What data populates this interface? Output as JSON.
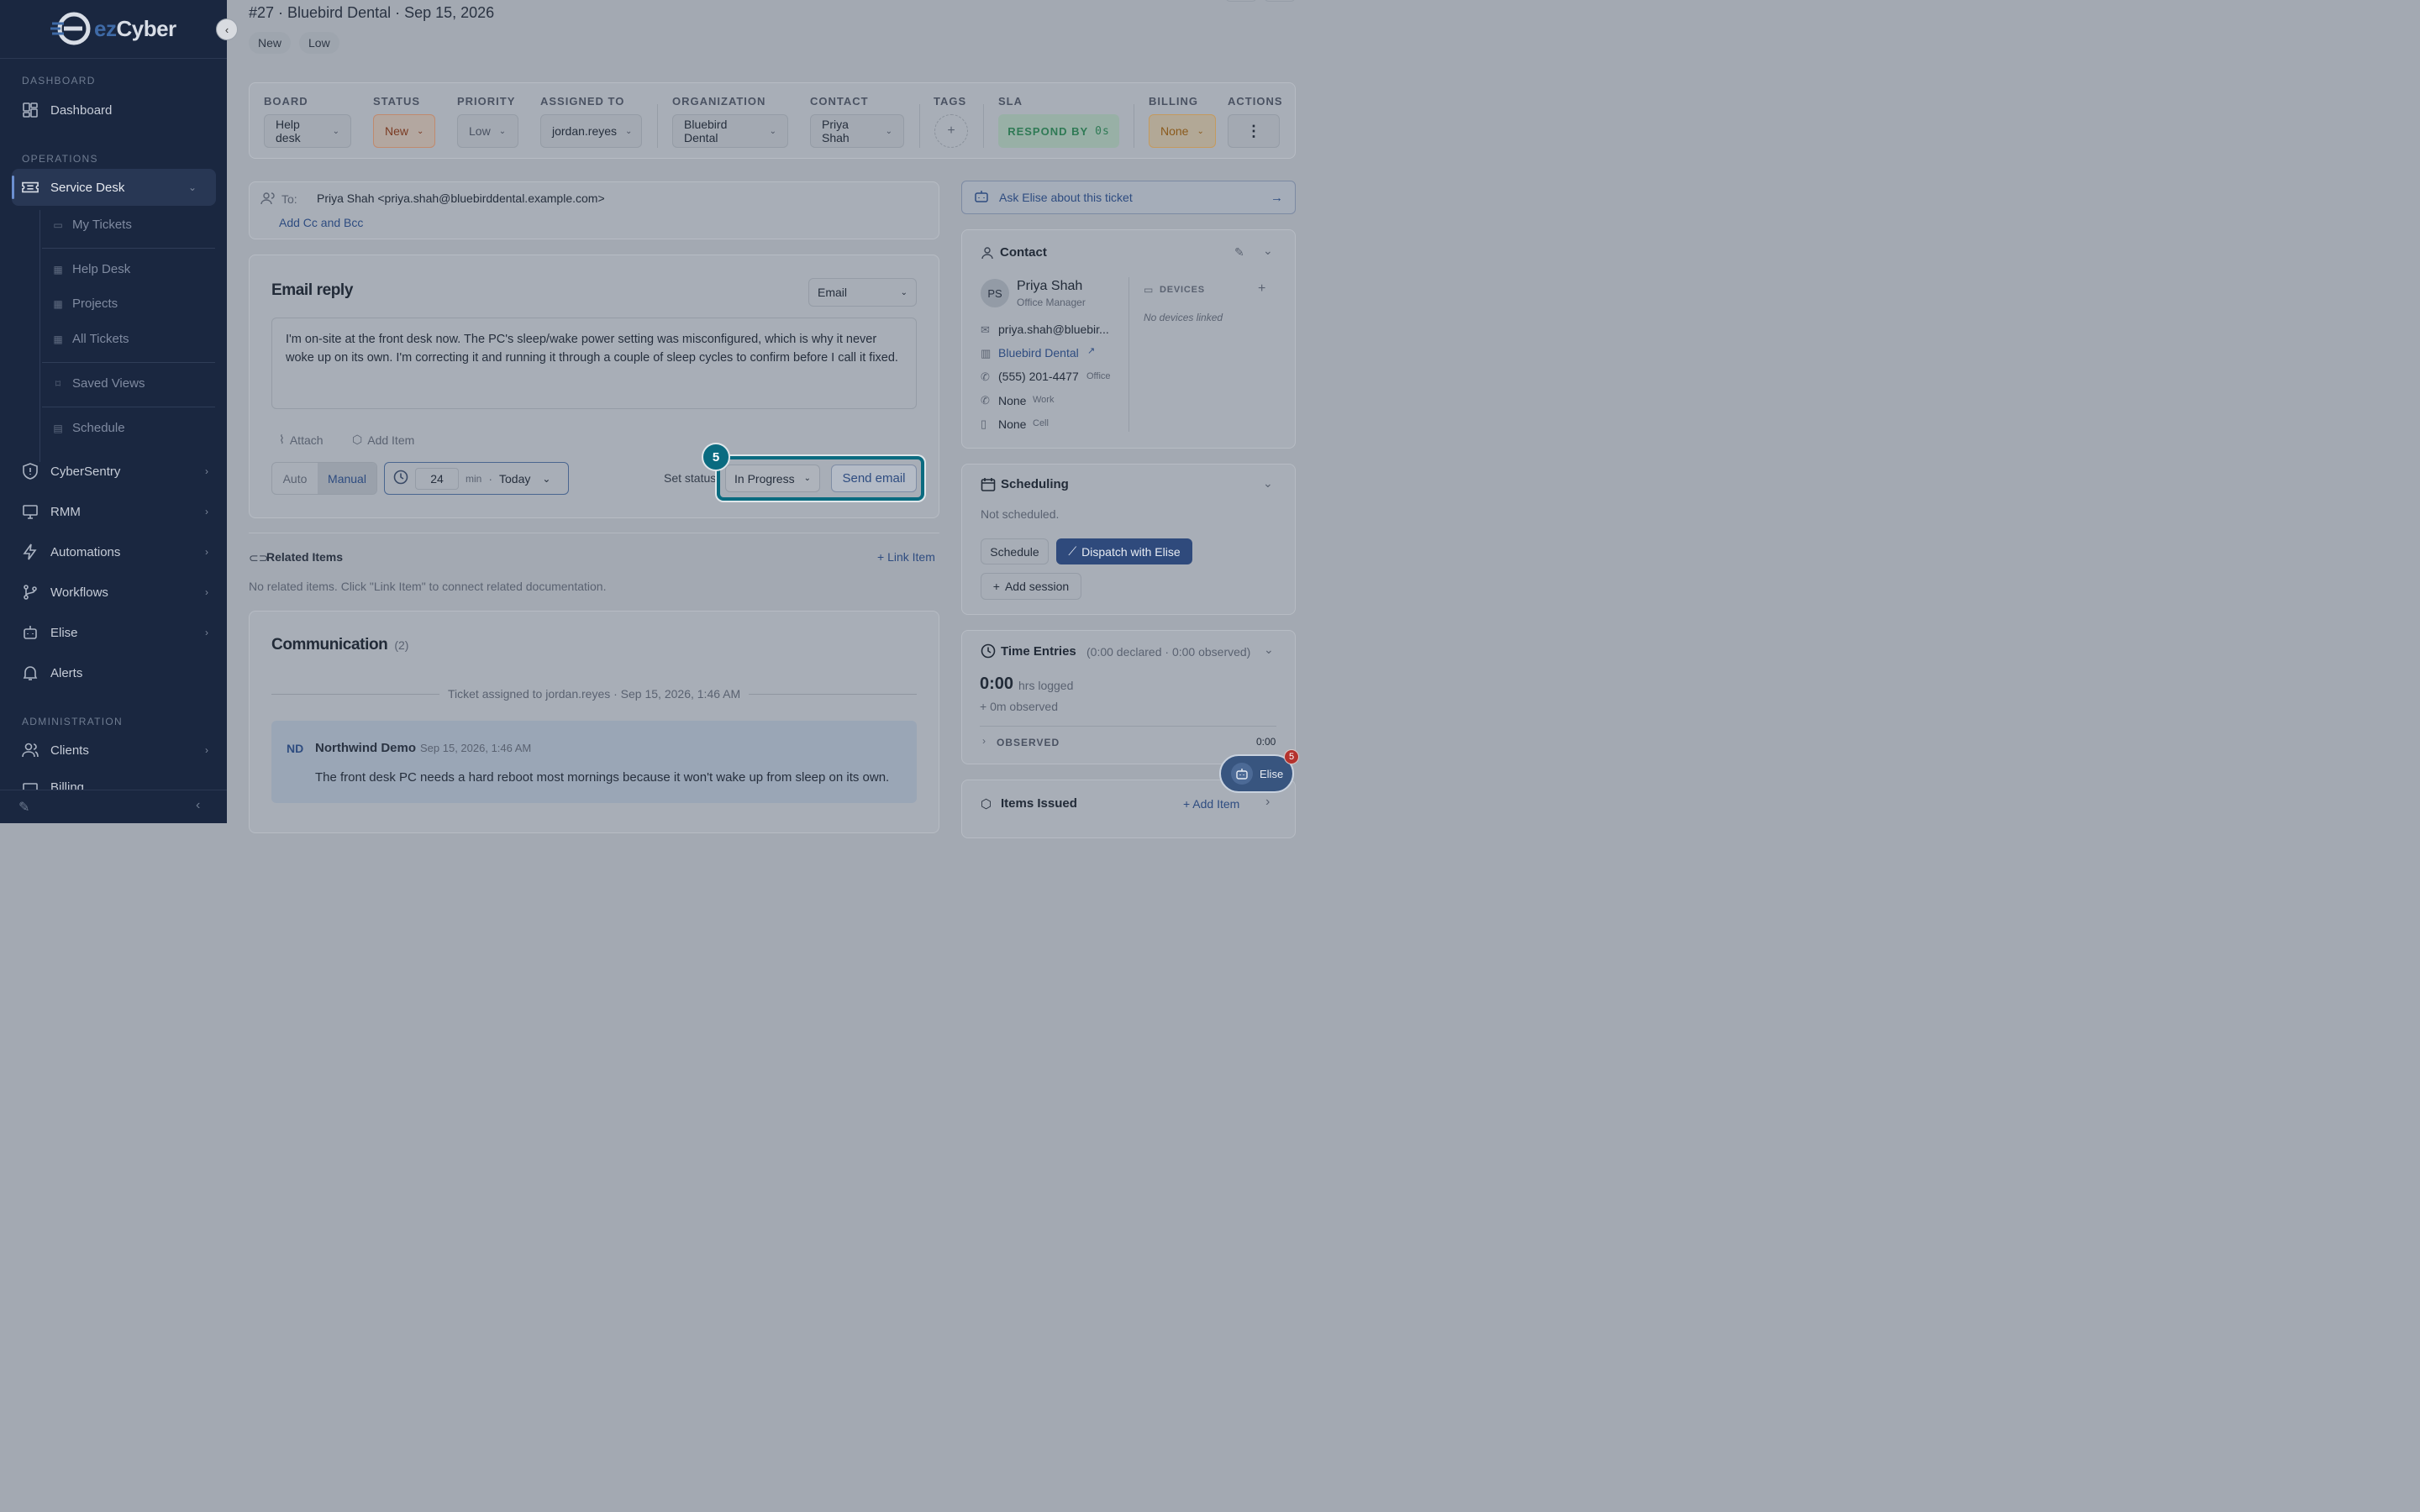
{
  "brand": {
    "logo_text_1": "ez",
    "logo_text_2": "Cyber"
  },
  "sidebar": {
    "sections": {
      "dashboard": "DASHBOARD",
      "operations": "OPERATIONS",
      "administration": "ADMINISTRATION"
    },
    "items": {
      "dashboard": "Dashboard",
      "service_desk": "Service Desk",
      "cybersentry": "CyberSentry",
      "rmm": "RMM",
      "automations": "Automations",
      "workflows": "Workflows",
      "elise": "Elise",
      "alerts": "Alerts",
      "clients": "Clients",
      "billing": "Billing"
    },
    "sub_items": {
      "my_tickets": "My Tickets",
      "help_desk": "Help Desk",
      "projects": "Projects",
      "all_tickets": "All Tickets",
      "saved_views": "Saved Views",
      "schedule": "Schedule"
    }
  },
  "ticket": {
    "title": "#27 · Bluebird Dental · Sep 15, 2026",
    "badges": [
      "New",
      "Low"
    ]
  },
  "fields": {
    "board": {
      "label": "BOARD",
      "value": "Help desk"
    },
    "status": {
      "label": "STATUS",
      "value": "New"
    },
    "priority": {
      "label": "PRIORITY",
      "value": "Low"
    },
    "assigned": {
      "label": "ASSIGNED TO",
      "value": "jordan.reyes"
    },
    "organization": {
      "label": "ORGANIZATION",
      "value": "Bluebird Dental"
    },
    "contact": {
      "label": "CONTACT",
      "value": "Priya Shah"
    },
    "tags": {
      "label": "TAGS",
      "value": "+"
    },
    "sla": {
      "label": "SLA",
      "value_prefix": "RESPOND BY",
      "value_time": "0s"
    },
    "billing": {
      "label": "BILLING",
      "value": "None"
    },
    "actions": {
      "label": "ACTIONS",
      "value": "⋮"
    }
  },
  "compose": {
    "to_label": "To:",
    "to_value": "Priya Shah <priya.shah@bluebirddental.example.com>",
    "cc_link": "Add Cc and Bcc",
    "title": "Email reply",
    "channel": "Email",
    "body": "I'm on-site at the front desk now. The PC's sleep/wake power setting was misconfigured, which is why it never woke up on its own. I'm correcting it and running it through a couple of sleep cycles to confirm before I call it fixed.",
    "attach": "Attach",
    "add_item": "Add Item",
    "auto": "Auto",
    "manual": "Manual",
    "minutes": "24",
    "min_label": "min",
    "day": "Today",
    "set_status_label": "Set status",
    "status_value": "In Progress",
    "send": "Send email",
    "step_badge": "5"
  },
  "related": {
    "title": "Related Items",
    "link": "+ Link Item",
    "empty": "No related items. Click \"Link Item\" to connect related documentation."
  },
  "communication": {
    "title": "Communication",
    "count": "(2)",
    "event": "Ticket assigned to jordan.reyes · Sep 15, 2026, 1:46 AM",
    "message": {
      "initials": "ND",
      "author": "Northwind Demo",
      "time": "Sep 15, 2026, 1:46 AM",
      "text": "The front desk PC needs a hard reboot most mornings because it won't wake up from sleep on its own."
    }
  },
  "right": {
    "ask_elise": "Ask Elise about this ticket",
    "contact": {
      "title": "Contact",
      "initials": "PS",
      "name": "Priya Shah",
      "role": "Office Manager",
      "email": "priya.shah@bluebir...",
      "org": "Bluebird Dental",
      "phone": "(555) 201-4477",
      "phone_type": "Office",
      "work": "None",
      "work_type": "Work",
      "cell": "None",
      "cell_type": "Cell",
      "devices_label": "DEVICES",
      "devices_empty": "No devices linked"
    },
    "scheduling": {
      "title": "Scheduling",
      "status": "Not scheduled.",
      "schedule_btn": "Schedule",
      "dispatch_btn": "Dispatch with Elise",
      "add_session": "Add session"
    },
    "time": {
      "title": "Time Entries",
      "summary": "(0:00 declared · 0:00 observed)",
      "logged_value": "0:00",
      "logged_label": "hrs logged",
      "observed": "+ 0m observed",
      "observed_label": "OBSERVED",
      "observed_value": "0:00"
    },
    "items_issued": {
      "title": "Items Issued",
      "add": "+ Add Item"
    },
    "elise_chat": {
      "label": "Elise",
      "badge": "5"
    }
  }
}
